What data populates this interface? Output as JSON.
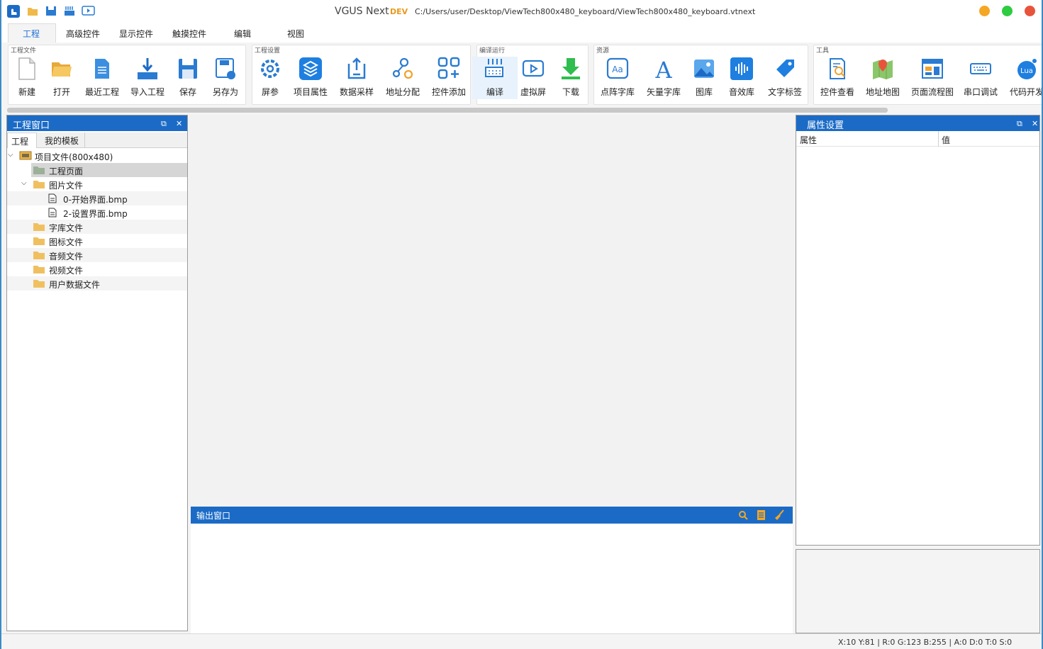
{
  "titlebar": {
    "app_name": "VGUS Next",
    "edition": "DEV",
    "file_path": "C:/Users/user/Desktop/ViewTech800x480_keyboard/ViewTech800x480_keyboard.vtnext",
    "window_controls": {
      "minimize_color": "#f5a623",
      "maximize_color": "#2ecc40",
      "close_color": "#e8533b"
    }
  },
  "menu": {
    "tabs": [
      "工程",
      "高级控件",
      "显示控件",
      "触摸控件",
      "编辑",
      "视图"
    ],
    "active": "工程"
  },
  "ribbon": {
    "groups": [
      {
        "title": "工程文件",
        "tools": [
          {
            "label": "新建",
            "icon": "new-file-icon"
          },
          {
            "label": "打开",
            "icon": "open-folder-icon"
          },
          {
            "label": "最近工程",
            "icon": "recent-project-icon"
          },
          {
            "label": "导入工程",
            "icon": "import-project-icon"
          },
          {
            "label": "保存",
            "icon": "save-icon"
          },
          {
            "label": "另存为",
            "icon": "save-as-icon"
          }
        ]
      },
      {
        "title": "工程设置",
        "tools": [
          {
            "label": "屏参",
            "icon": "screen-settings-icon"
          },
          {
            "label": "项目属性",
            "icon": "project-properties-icon"
          },
          {
            "label": "数据采样",
            "icon": "data-sampling-icon"
          },
          {
            "label": "地址分配",
            "icon": "address-allocation-icon"
          },
          {
            "label": "控件添加",
            "icon": "add-widget-icon"
          }
        ]
      },
      {
        "title": "编译运行",
        "tools": [
          {
            "label": "编译",
            "icon": "compile-icon"
          },
          {
            "label": "虚拟屏",
            "icon": "virtual-screen-icon"
          },
          {
            "label": "下载",
            "icon": "download-icon"
          }
        ]
      },
      {
        "title": "资源",
        "tools": [
          {
            "label": "点阵字库",
            "icon": "bitmap-font-icon"
          },
          {
            "label": "矢量字库",
            "icon": "vector-font-icon"
          },
          {
            "label": "图库",
            "icon": "image-library-icon"
          },
          {
            "label": "音效库",
            "icon": "sound-library-icon"
          },
          {
            "label": "文字标签",
            "icon": "text-tag-icon"
          }
        ]
      },
      {
        "title": "工具",
        "tools": [
          {
            "label": "控件查看",
            "icon": "widget-inspect-icon"
          },
          {
            "label": "地址地图",
            "icon": "address-map-icon"
          },
          {
            "label": "页面流程图",
            "icon": "page-flowchart-icon"
          },
          {
            "label": "串口调试",
            "icon": "serial-debug-icon"
          },
          {
            "label": "代码开发",
            "icon": "lua-code-icon"
          }
        ]
      }
    ]
  },
  "project_panel": {
    "title": "工程窗口",
    "tabs": [
      "工程",
      "我的模板"
    ],
    "tree": [
      {
        "label": "项目文件(800x480)",
        "level": 0,
        "expanded": true,
        "type": "project"
      },
      {
        "label": "工程页面",
        "level": 1,
        "type": "folder",
        "selected": true
      },
      {
        "label": "图片文件",
        "level": 1,
        "expanded": true,
        "type": "folder"
      },
      {
        "label": "0-开始界面.bmp",
        "level": 2,
        "type": "file"
      },
      {
        "label": "2-设置界面.bmp",
        "level": 2,
        "type": "file"
      },
      {
        "label": "字库文件",
        "level": 1,
        "type": "folder"
      },
      {
        "label": "图标文件",
        "level": 1,
        "type": "folder"
      },
      {
        "label": "音频文件",
        "level": 1,
        "type": "folder"
      },
      {
        "label": "视频文件",
        "level": 1,
        "type": "folder"
      },
      {
        "label": "用户数据文件",
        "level": 1,
        "type": "folder"
      }
    ]
  },
  "output_panel": {
    "title": "输出窗口"
  },
  "property_panel": {
    "title": "属性设置",
    "columns": [
      "属性",
      "值"
    ]
  },
  "statusbar": {
    "text": "X:10  Y:81   |   R:0 G:123 B:255   |   A:0  D:0  T:0  S:0"
  },
  "colors": {
    "accent": "#1b6bc6",
    "tab_active_text": "#1e6fd6",
    "folder": "#f0b94a"
  }
}
